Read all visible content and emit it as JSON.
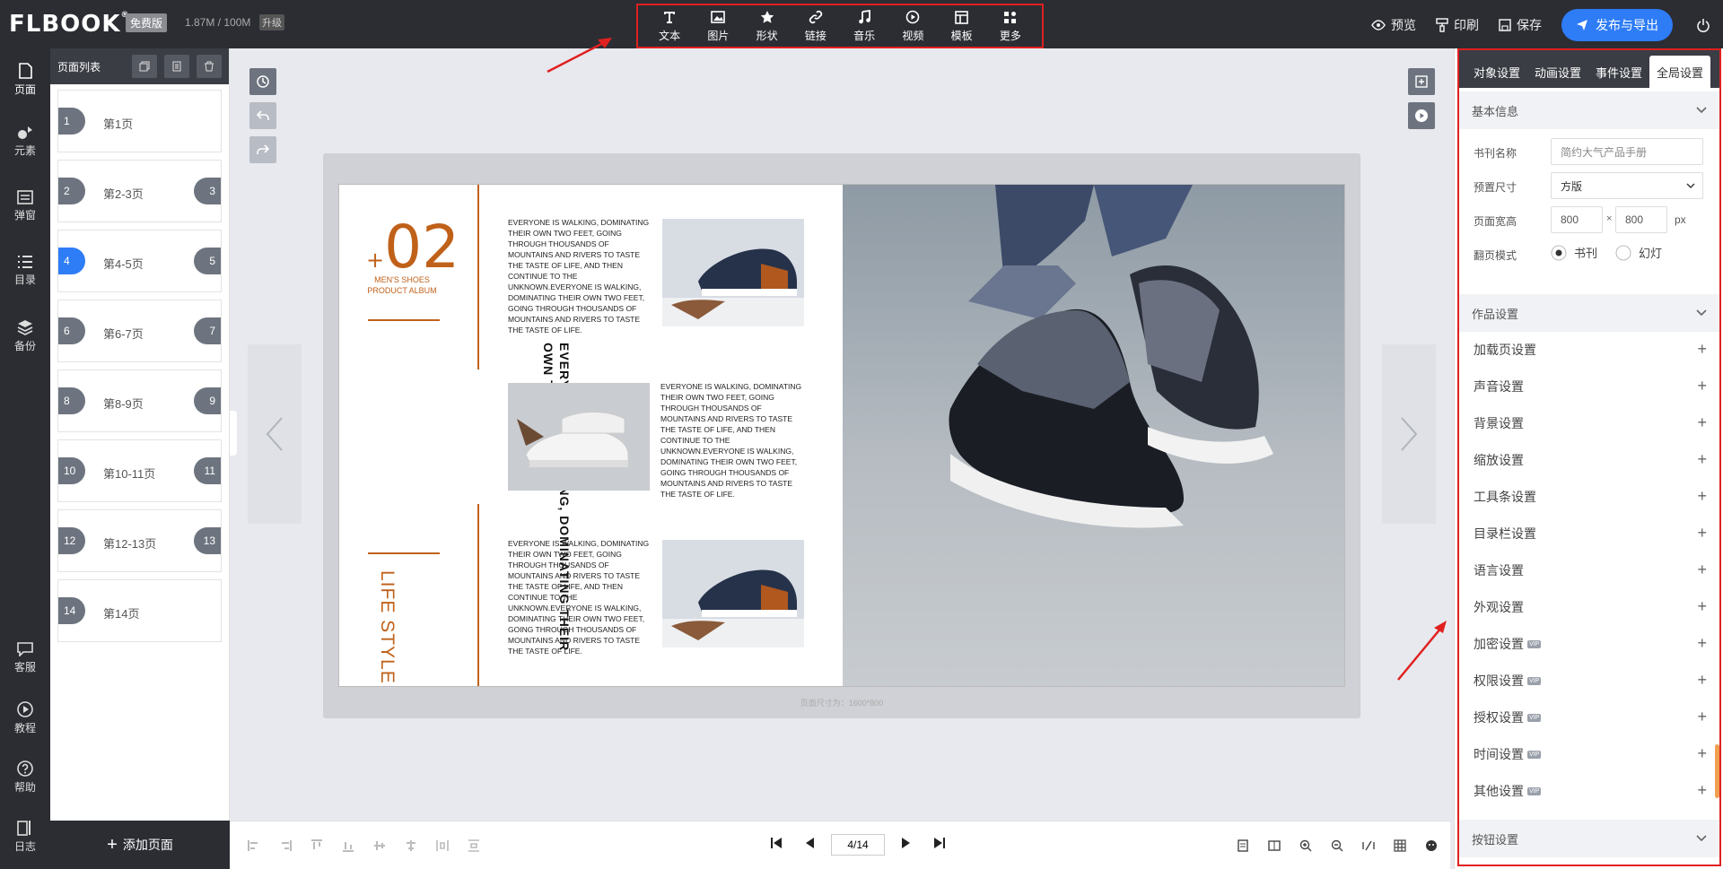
{
  "app": {
    "logo": "FLBOOK",
    "logo_reg": "®",
    "plan_badge": "免费版",
    "storage": "1.87M / 100M",
    "upgrade": "升级"
  },
  "toolbar": {
    "items": [
      {
        "label": "文本",
        "icon": "text-icon"
      },
      {
        "label": "图片",
        "icon": "image-icon"
      },
      {
        "label": "形状",
        "icon": "star-icon"
      },
      {
        "label": "链接",
        "icon": "link-icon"
      },
      {
        "label": "音乐",
        "icon": "music-icon"
      },
      {
        "label": "视频",
        "icon": "play-circle-icon"
      },
      {
        "label": "模板",
        "icon": "template-icon"
      },
      {
        "label": "更多",
        "icon": "more-grid-icon"
      }
    ]
  },
  "top_right": {
    "preview": "预览",
    "print": "印刷",
    "save": "保存",
    "publish": "发布与导出"
  },
  "leftnav": {
    "items": [
      {
        "label": "页面",
        "icon": "page-icon"
      },
      {
        "label": "元素",
        "icon": "element-icon"
      },
      {
        "label": "弹窗",
        "icon": "popup-icon"
      },
      {
        "label": "目录",
        "icon": "list-icon"
      },
      {
        "label": "备份",
        "icon": "stack-icon"
      },
      {
        "label": "客服",
        "icon": "chat-icon"
      },
      {
        "label": "教程",
        "icon": "play-icon"
      },
      {
        "label": "帮助",
        "icon": "help-icon"
      },
      {
        "label": "日志",
        "icon": "log-icon"
      }
    ]
  },
  "pagepanel": {
    "title": "页面列表",
    "add_page": "添加页面",
    "pages": [
      {
        "label": "第1页",
        "left": "1",
        "right": ""
      },
      {
        "label": "第2-3页",
        "left": "2",
        "right": "3"
      },
      {
        "label": "第4-5页",
        "left": "4",
        "right": "5",
        "active": true
      },
      {
        "label": "第6-7页",
        "left": "6",
        "right": "7"
      },
      {
        "label": "第8-9页",
        "left": "8",
        "right": "9"
      },
      {
        "label": "第10-11页",
        "left": "10",
        "right": "11"
      },
      {
        "label": "第12-13页",
        "left": "12",
        "right": "13"
      },
      {
        "label": "第14页",
        "left": "14",
        "right": ""
      }
    ]
  },
  "book": {
    "number": "02",
    "plus": "+",
    "subtitle_1": "MEN'S SHOES",
    "subtitle_2": "PRODUCT ALBUM",
    "vertical_text": "EVERYONE IS WALKING, DOMINATING THEIR OWN TWO FEET.",
    "life_style": "LIFE STYLE",
    "paragraph": "EVERYONE IS WALKING, DOMINATING THEIR OWN TWO FEET, GOING THROUGH THOUSANDS OF MOUNTAINS AND RIVERS TO TASTE THE TASTE OF LIFE, AND THEN CONTINUE TO THE UNKNOWN.EVERYONE IS WALKING, DOMINATING THEIR OWN TWO FEET, GOING THROUGH THOUSANDS OF MOUNTAINS AND RIVERS TO TASTE THE TASTE OF LIFE.",
    "page_size": "页面尺寸为：1600*800"
  },
  "pager": {
    "current": "4/14"
  },
  "rightpanel": {
    "tabs": [
      "对象设置",
      "动画设置",
      "事件设置",
      "全局设置"
    ],
    "basic_info": "基本信息",
    "book_name_label": "书刊名称",
    "book_name_value": "简约大气产品手册",
    "preset_size_label": "预置尺寸",
    "preset_size_value": "方版",
    "page_wh_label": "页面宽高",
    "width": "800",
    "times": "×",
    "height": "800",
    "unit": "px",
    "flip_mode_label": "翻页模式",
    "flip_book": "书刊",
    "flip_slide": "幻灯",
    "work_settings": "作品设置",
    "items": [
      {
        "label": "加载页设置",
        "vip": false
      },
      {
        "label": "声音设置",
        "vip": false
      },
      {
        "label": "背景设置",
        "vip": false
      },
      {
        "label": "缩放设置",
        "vip": false
      },
      {
        "label": "工具条设置",
        "vip": false
      },
      {
        "label": "目录栏设置",
        "vip": false
      },
      {
        "label": "语言设置",
        "vip": false
      },
      {
        "label": "外观设置",
        "vip": false
      },
      {
        "label": "加密设置",
        "vip": true
      },
      {
        "label": "权限设置",
        "vip": true
      },
      {
        "label": "授权设置",
        "vip": true
      },
      {
        "label": "时间设置",
        "vip": true
      },
      {
        "label": "其他设置",
        "vip": true
      }
    ],
    "vip_badge": "VIP",
    "button_settings": "按钮设置"
  },
  "colors": {
    "accent": "#2e7cf6",
    "brand_orange": "#c0611a",
    "highlight_red": "#e02020",
    "dark_bg": "#2b2d33"
  }
}
